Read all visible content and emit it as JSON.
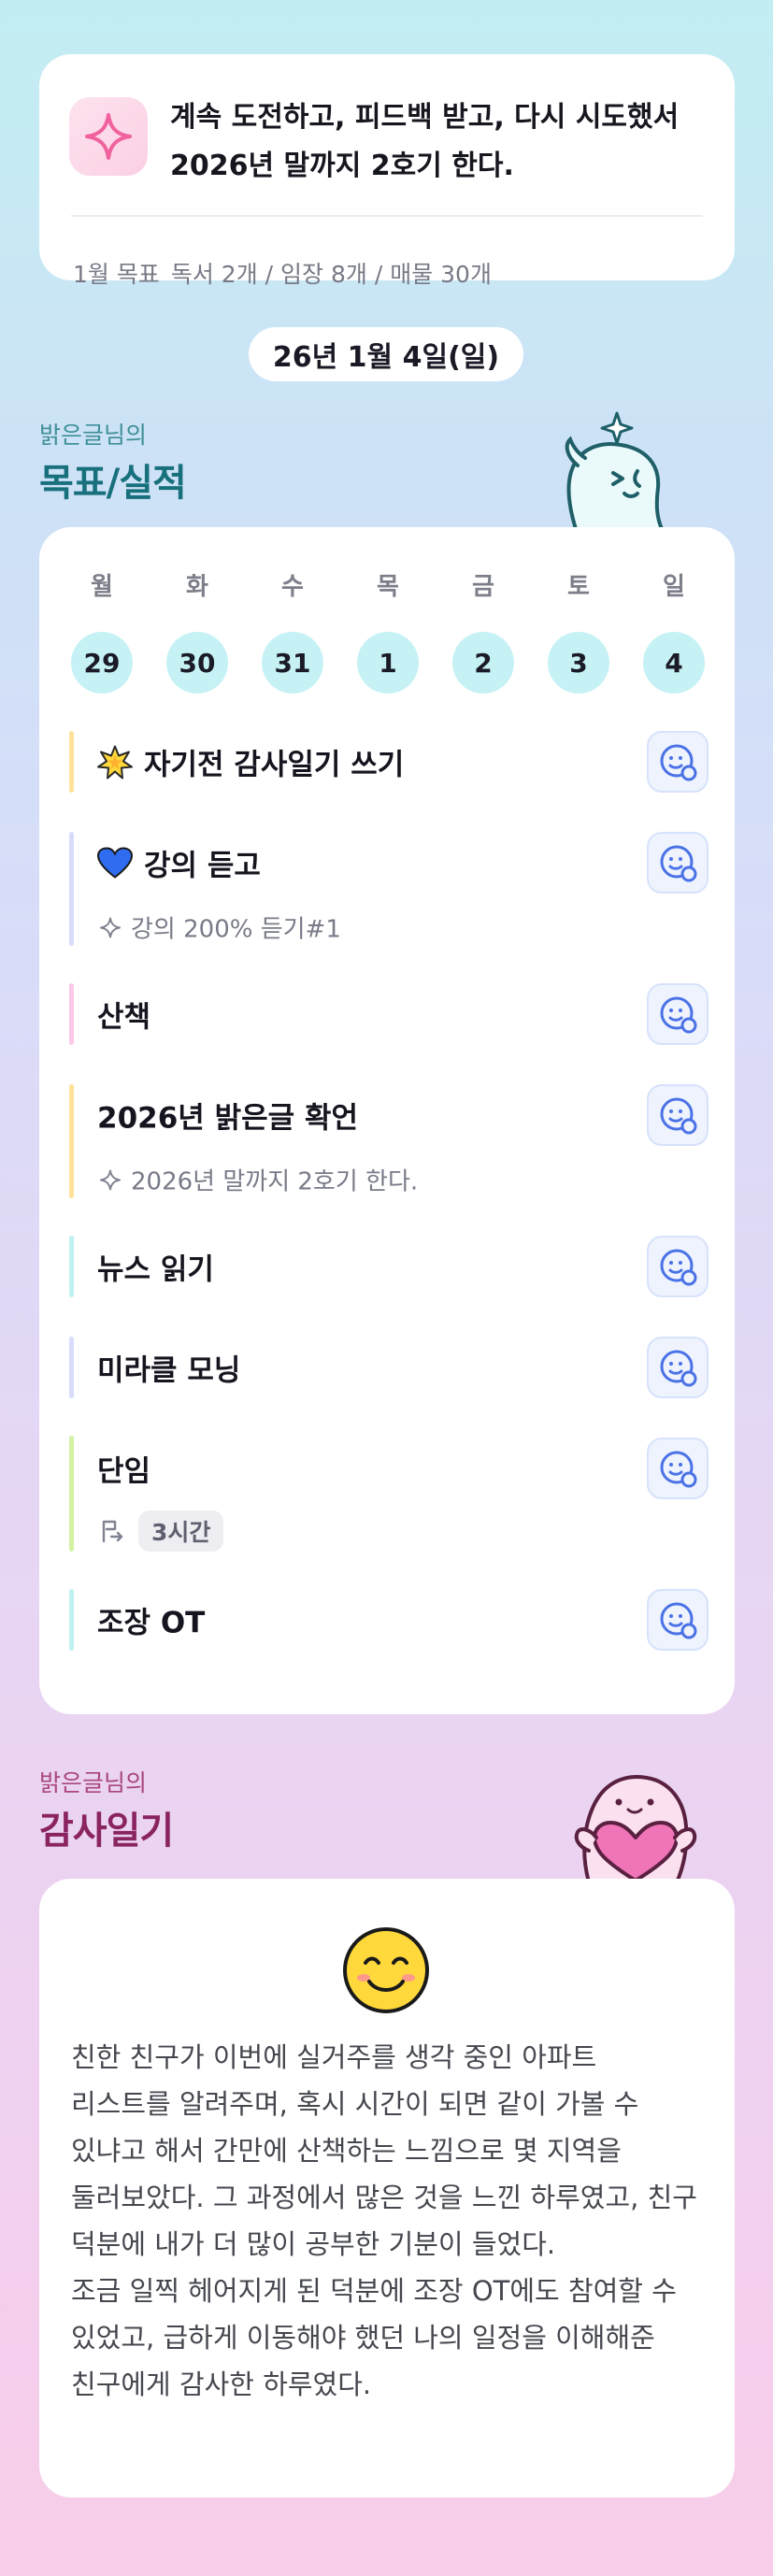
{
  "goal": {
    "text": "계속 도전하고, 피드백 받고, 다시 시도했서 2026년 말까지 2호기 한다.",
    "month_label": "1월 목표",
    "month_targets": "독서 2개 / 임장 8개 / 매물 30개",
    "icon": "sparkle-icon"
  },
  "date": "26년 1월 4일(일)",
  "goals_section": {
    "small": "밝은글님의",
    "big": "목표/실적"
  },
  "week": {
    "days": [
      "월",
      "화",
      "수",
      "목",
      "금",
      "토",
      "일"
    ],
    "dates": [
      "29",
      "30",
      "31",
      "1",
      "2",
      "3",
      "4"
    ]
  },
  "tasks": [
    {
      "title": "자기전 감사일기 쓰기",
      "emoji": "star-burst-icon",
      "bar_color": "#ffe19a"
    },
    {
      "title": "강의 듣고",
      "emoji": "blue-heart-icon",
      "bar_color": "#d7dcfb",
      "sub": "강의 200% 듣기#1",
      "sub_icon": "sparkle-icon"
    },
    {
      "title": "산책",
      "bar_color": "#fdc9e6"
    },
    {
      "title": "2026년 밝은글 확언",
      "bar_color": "#ffe19a",
      "sub": "2026년 말까지 2호기 한다.",
      "sub_icon": "sparkle-icon"
    },
    {
      "title": "뉴스 읽기",
      "bar_color": "#bff1f1"
    },
    {
      "title": "미라클 모닝",
      "bar_color": "#d7dcfb"
    },
    {
      "title": "단임",
      "bar_color": "#d3f2a4",
      "chip": "3시간",
      "sub_icon": "flag-arrow-icon"
    },
    {
      "title": "조장 OT",
      "bar_color": "#bff1f1"
    }
  ],
  "journal_section": {
    "small": "밝은글님의",
    "big": "감사일기"
  },
  "journal": {
    "emoji": "smiling-face-icon",
    "paragraph1": "친한 친구가 이번에 실거주를 생각 중인 아파트 리스트를 알려주며, 혹시 시간이 되면 같이 가볼 수 있냐고 해서 간만에 산책하는 느낌으로 몇 지역을 둘러보았다. 그 과정에서 많은 것을 느낀 하루였고, 친구 덕분에 내가 더 많이 공부한 기분이 들었다.",
    "paragraph2": "조금 일찍 헤어지게 된 덕분에 조장 OT에도 참여할 수 있었고, 급하게 이동해야 했던 나의 일정을 이해해준 친구에게 감사한 하루였다."
  },
  "colors": {
    "accent_teal": "#17707c",
    "accent_pink": "#8a2460",
    "day_circle": "#c6f2f5",
    "check_icon": "#4a72e6"
  }
}
